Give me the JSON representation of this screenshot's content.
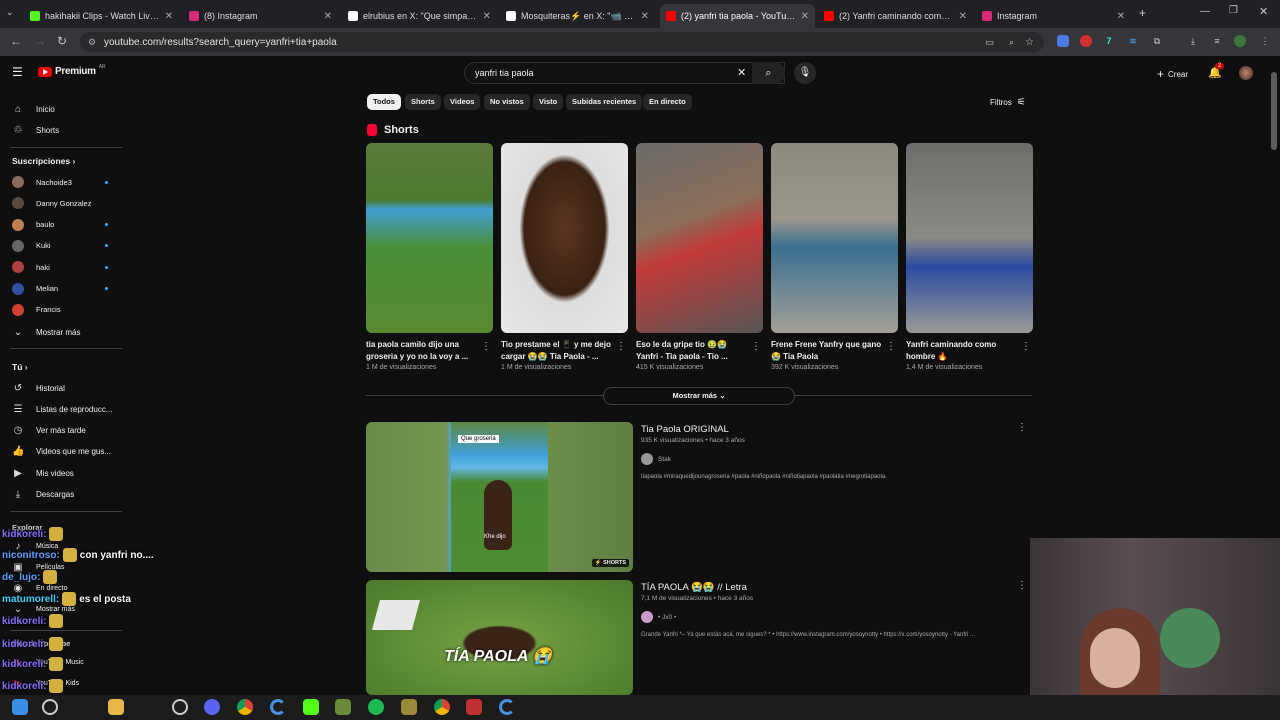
{
  "browser": {
    "tabs": [
      {
        "title": "hakihakii Clips - Watch Live on",
        "color": "#53fc18"
      },
      {
        "title": "(8) Instagram",
        "color": "#d62976"
      },
      {
        "title": "elrubius en X: \"Que simpaticos",
        "color": "#ffffff"
      },
      {
        "title": "Mosquiteras⚡ en X: \"📹 Primer",
        "color": "#ffffff"
      },
      {
        "title": "(2) yanfri tia paola - YouTube",
        "color": "#ff0000"
      },
      {
        "title": "(2) Yanfri caminando como hom",
        "color": "#ff0000"
      },
      {
        "title": "Instagram",
        "color": "#d62976"
      }
    ],
    "url": "youtube.com/results?search_query=yanfri+tia+paola"
  },
  "yt_header": {
    "logo": "Premium",
    "region": "AR",
    "search_value": "yanfri tia paola",
    "create_label": "Crear",
    "notif_count": "2"
  },
  "sidebar": {
    "main": [
      {
        "label": "Inicio",
        "icon": "home-icon",
        "glyph": "⌂"
      },
      {
        "label": "Shorts",
        "icon": "shorts-icon",
        "glyph": "♲"
      }
    ],
    "subs_title": "Suscripciones",
    "subs": [
      {
        "label": "Nachoide3",
        "color": "#8a6b5c"
      },
      {
        "label": "Danny Gonzalez",
        "color": "#5b4a3c"
      },
      {
        "label": "baulo",
        "color": "#c08050"
      },
      {
        "label": "Kuki",
        "color": "#666"
      },
      {
        "label": "haki",
        "color": "#b04040"
      },
      {
        "label": "Melian",
        "color": "#3050a0"
      },
      {
        "label": "Francis",
        "color": "#d04030"
      }
    ],
    "show_more": "Mostrar más",
    "you_title": "Tú",
    "you": [
      {
        "label": "Historial",
        "icon": "history-icon",
        "glyph": "↺"
      },
      {
        "label": "Listas de reproducc...",
        "icon": "playlist-icon",
        "glyph": "☰"
      },
      {
        "label": "Ver más tarde",
        "icon": "watch-later-icon",
        "glyph": "◷"
      },
      {
        "label": "Videos que me gus...",
        "icon": "like-icon",
        "glyph": "👍"
      },
      {
        "label": "Mis videos",
        "icon": "my-videos-icon",
        "glyph": "▶"
      },
      {
        "label": "Descargas",
        "icon": "download-icon",
        "glyph": "⤓"
      }
    ],
    "explore_title": "Explorar",
    "explore": [
      {
        "label": "Música",
        "icon": "music-icon",
        "glyph": "♪"
      },
      {
        "label": "Películas",
        "icon": "movies-icon",
        "glyph": "▣"
      },
      {
        "label": "En directo",
        "icon": "live-icon",
        "glyph": "◉"
      },
      {
        "label": "Mostrar más",
        "icon": "chevron-down-icon",
        "glyph": "⌄"
      }
    ],
    "more_title": "Más de YouTube",
    "more": [
      {
        "label": "YouTube Music",
        "color": "#ff0000"
      },
      {
        "label": "YouTube Kids",
        "color": "#ff0000"
      }
    ]
  },
  "chips": [
    "Todos",
    "Shorts",
    "Videos",
    "No vistos",
    "Visto",
    "Subidas recientes",
    "En directo"
  ],
  "filters_label": "Filtros",
  "shorts_section": {
    "title": "Shorts",
    "items": [
      {
        "title": "tia paola camilo dijo una groseria y yo no la voy a ...",
        "views": "1 M de visualizaciones",
        "bg": "linear-gradient(180deg,#5c7a3d 0%,#4d7a2e 30%,#3f9fd1 35%,#4a8f38 55%,#5a8a32 100%)"
      },
      {
        "title": "Tio prestame el 📱 y me dejo cargar 😭😭 Tia Paola - ...",
        "views": "1 M de visualizaciones",
        "bg": "radial-gradient(ellipse at 50% 45%,#5a3520 0%,#3a2214 45%,#ddd 50%,#e8e8e8 100%)"
      },
      {
        "title": "Eso le da gripe tio 🤢😭 Yanfri - Tia paola - Tio ...",
        "views": "415 K visualizaciones",
        "bg": "linear-gradient(160deg,#6b6b6b 0%,#8a6e5a 40%,#c23a3a 55%,#555 100%)"
      },
      {
        "title": "Frene Frene Yanfry que gano 😭 Tia Paola",
        "views": "392 K visualizaciones",
        "bg": "linear-gradient(180deg,#8e8a80 0%,#9a968c 40%,#3b6f8f 55%,#a4a097 100%)"
      },
      {
        "title": "Yanfri caminando como hombre 🔥",
        "views": "1,4 M de visualizaciones",
        "bg": "linear-gradient(180deg,#6d6d6b 0%,#8a8a86 50%,#2b4aa0 65%,#9a9a96 100%)"
      }
    ]
  },
  "show_more_shorts": "Mostrar más",
  "videos": [
    {
      "title": "Tia Paola ORIGINAL",
      "meta": "935 K visualizaciones • hace 3 años",
      "channel": "Stak",
      "desc": "tiapaola #miraquedijounagroseria #paola #niñopaola #niñotiapaola #paolatia #negrotiapaola.",
      "overlay_label": "Que groseria",
      "badge": "SHORTS",
      "caption": "Khe dijo"
    },
    {
      "title": "TÍA PAOLA 😭😭 // Letra",
      "meta": "7,1 M de visualizaciones • hace 3 años",
      "channel": "• Jx0 •",
      "desc": "Grande Yanfri *– Ya que estás acá, me sigues? * • https://www.instagram.com/yosoynotty • https://x.com/yosoynotty - Yanfri ...",
      "overlay_text": "TÍA PAOLA 😭"
    }
  ],
  "chat": [
    {
      "user": "kidkoreli:",
      "msg": "",
      "color": "#8a6cff"
    },
    {
      "user": "niconitroso:",
      "msg": "con yanfri no....",
      "color": "#5aa0ff"
    },
    {
      "user": "de_lujo:",
      "msg": "",
      "color": "#5aa0ff"
    },
    {
      "user": "matumorell:",
      "msg": "es el posta",
      "color": "#3cd6ff"
    },
    {
      "user": "kidkoreli:",
      "msg": "",
      "color": "#8a6cff"
    },
    {
      "user": "kidkoreli:",
      "msg": "",
      "color": "#8a6cff"
    },
    {
      "user": "kidkoreli:",
      "msg": "",
      "color": "#8a6cff"
    },
    {
      "user": "kidkoreli:",
      "msg": "",
      "color": "#8a6cff"
    },
    {
      "user": "niconitroso:",
      "msg": "con yanfri no....",
      "color": "#5aa0ff"
    }
  ]
}
